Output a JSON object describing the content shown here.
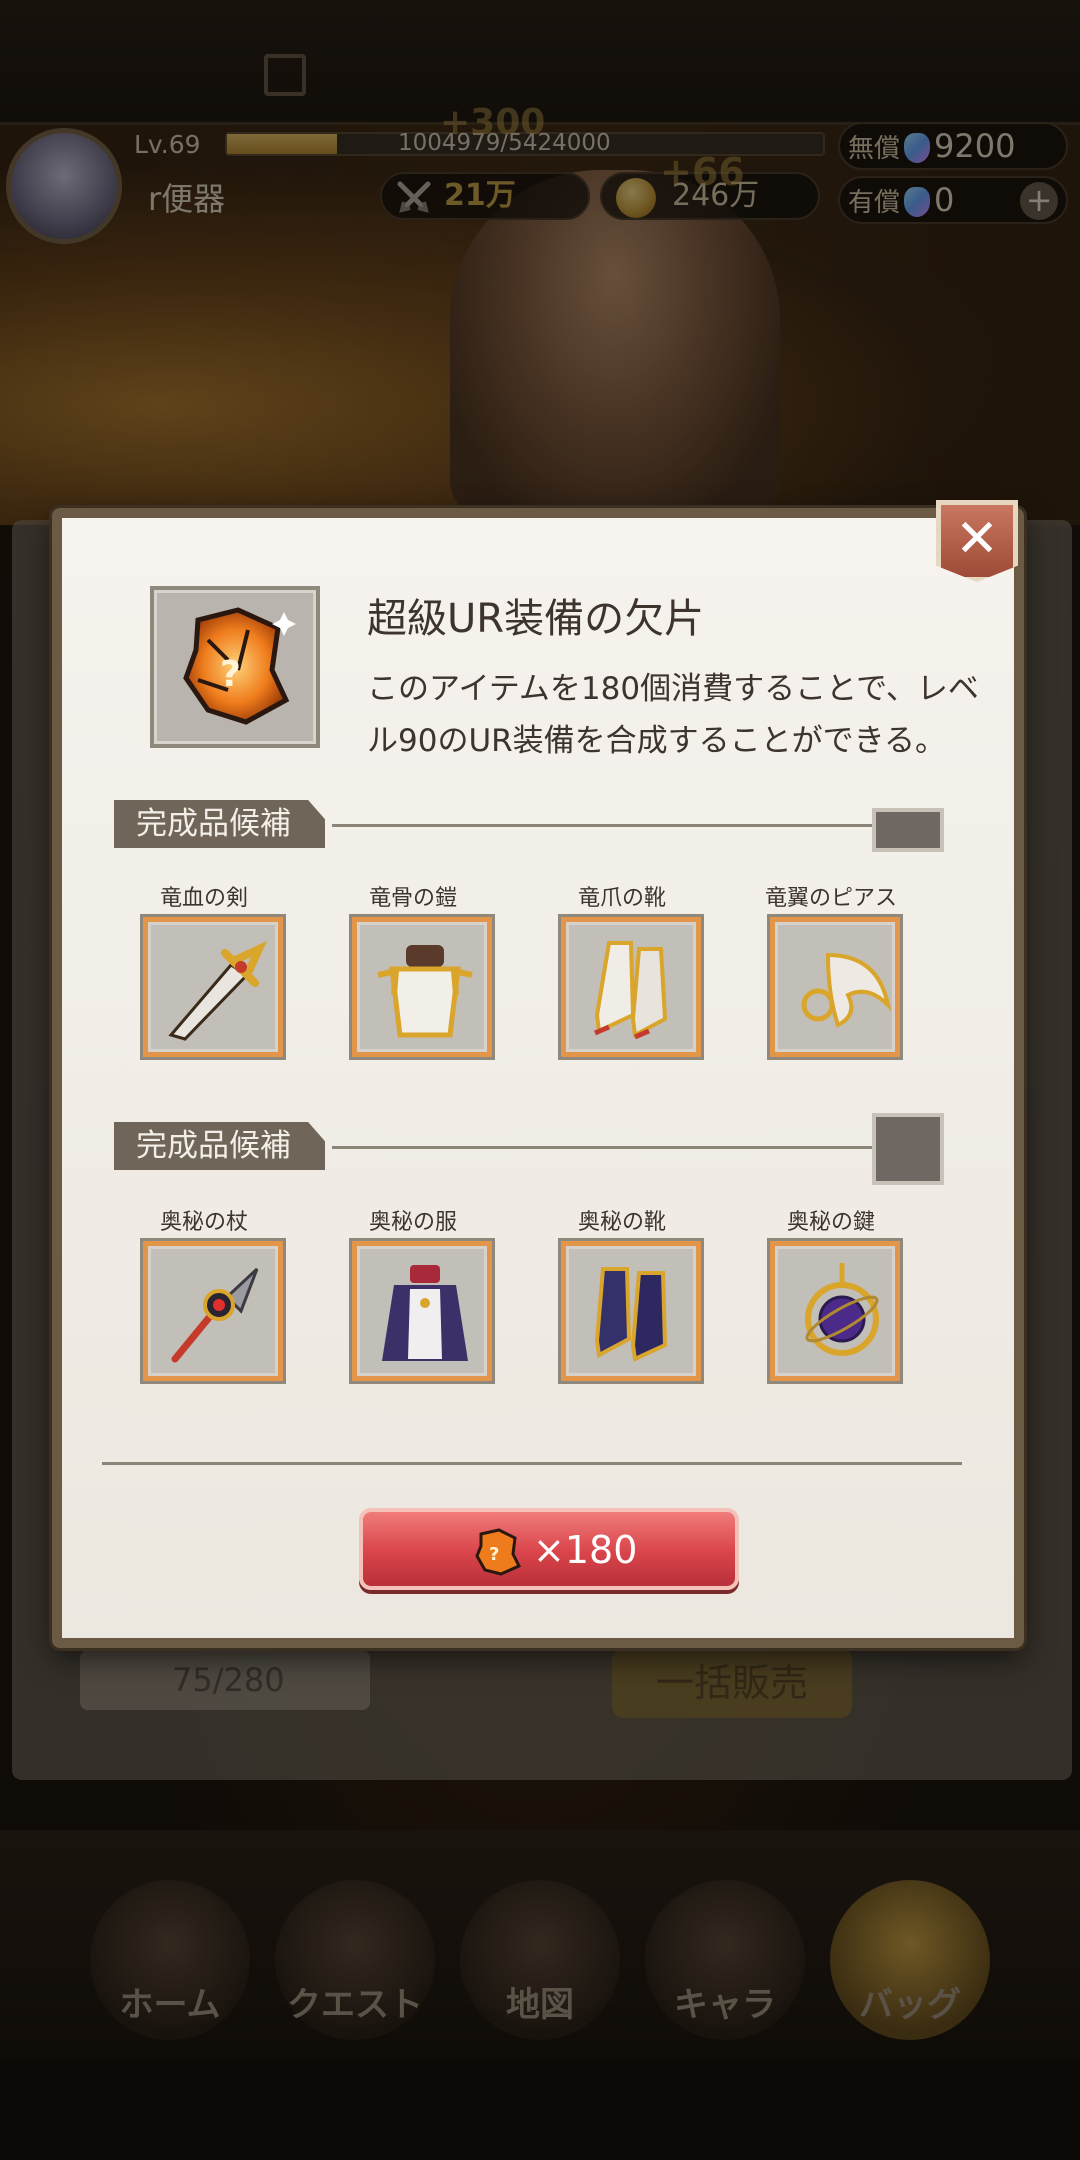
{
  "hud": {
    "level": "Lv.69",
    "exp_text": "1004979/5424000",
    "exp_fraction": 0.185,
    "player_name": "r便器",
    "power": "21万",
    "gold": "246万",
    "free_gems_label": "無償",
    "free_gems": "9200",
    "paid_gems_label": "有償",
    "paid_gems": "0",
    "float_top": "+300",
    "float_gold": "+66"
  },
  "background": {
    "bag_count": "75/280",
    "sell_button": "一括販売",
    "nav": [
      {
        "label": "ホーム"
      },
      {
        "label": "クエスト"
      },
      {
        "label": "地図"
      },
      {
        "label": "キャラ"
      },
      {
        "label": "バッグ"
      }
    ]
  },
  "modal": {
    "close_label": "✕",
    "title": "超級UR装備の欠片",
    "description": "このアイテムを180個消費することで、レベル90のUR装備を合成することができる。",
    "section_label": "完成品候補",
    "group1": [
      {
        "name": "竜血の剣",
        "icon": "dragon-blood-sword-icon"
      },
      {
        "name": "竜骨の鎧",
        "icon": "dragon-bone-armor-icon"
      },
      {
        "name": "竜爪の靴",
        "icon": "dragon-claw-boots-icon"
      },
      {
        "name": "竜翼のピアス",
        "icon": "dragon-wing-earring-icon"
      }
    ],
    "group2": [
      {
        "name": "奥秘の杖",
        "icon": "arcane-staff-icon"
      },
      {
        "name": "奥秘の服",
        "icon": "arcane-robe-icon"
      },
      {
        "name": "奥秘の靴",
        "icon": "arcane-boots-icon"
      },
      {
        "name": "奥秘の鍵",
        "icon": "arcane-key-icon"
      }
    ],
    "craft_button_qty": "×180"
  },
  "colors": {
    "craft_button": "#d9444a",
    "modal_bg": "#f3f0ea",
    "frame": "#6b5a44",
    "card_glow": "#e3954a"
  }
}
